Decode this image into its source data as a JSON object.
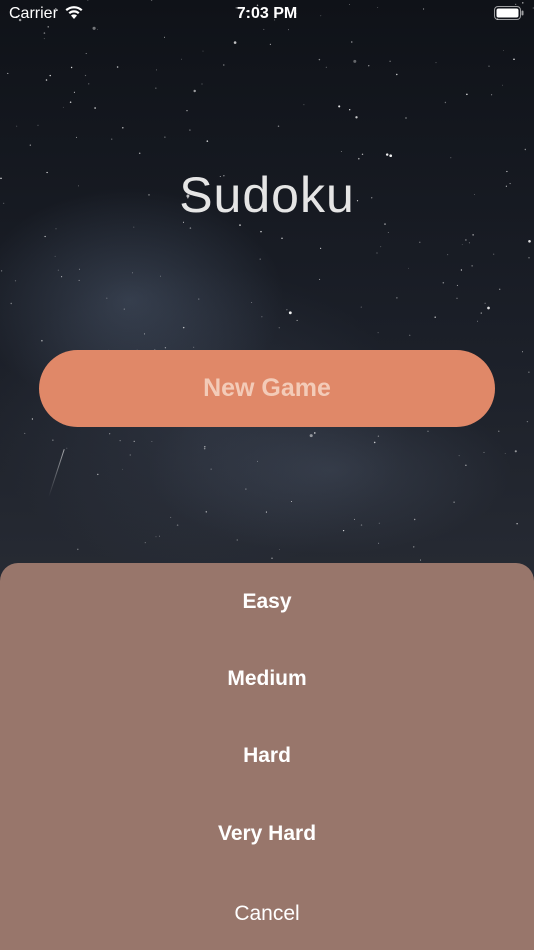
{
  "status_bar": {
    "carrier": "Carrier",
    "time": "7:03 PM",
    "icons": [
      "wifi-icon",
      "battery-icon"
    ]
  },
  "app": {
    "title": "Sudoku",
    "new_game_label": "New Game"
  },
  "difficulty_sheet": {
    "options": [
      {
        "label": "Easy"
      },
      {
        "label": "Medium"
      },
      {
        "label": "Hard"
      },
      {
        "label": "Very Hard"
      }
    ],
    "cancel_label": "Cancel"
  },
  "colors": {
    "accent": "#e08868",
    "sheet": "#98766b",
    "title": "#e5e5e5"
  }
}
